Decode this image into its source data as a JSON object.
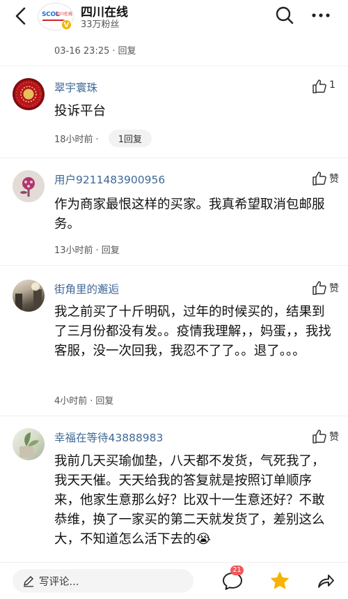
{
  "header": {
    "account_name": "四川在线",
    "fans": "33万粉丝",
    "logo_text": "SCOL",
    "logo_sub": "四川在线",
    "verified_mark": "V"
  },
  "top_comment": {
    "time": "03-16 23:25",
    "reply": "回复"
  },
  "comments": [
    {
      "user": "翠宇寰珠",
      "text": "投诉平台",
      "time": "18小时前",
      "reply": "1回复",
      "likes": "1"
    },
    {
      "user": "用户9211483900956",
      "text": "作为商家最恨这样的买家。我真希望取消包邮服务。",
      "time": "13小时前",
      "reply": "回复",
      "likes": "赞"
    },
    {
      "user": "街角里的邂逅",
      "text": "我之前买了十斤明矾，过年的时候买的，结果到了三月份都没有发。。疫情我理解，，妈蛋，，我找客服，没一次回我，我忍不了了。。退了。。。",
      "time": "4小时前",
      "reply": "回复",
      "likes": "赞"
    },
    {
      "user": "幸福在等待43888983",
      "text": "我前几天买瑜伽垫，八天都不发货，气死我了，我天天催。天天给我的答复就是按照订单顺序来，他家生意那么好？比双十一生意还好？不敢恭维，换了一家买的第二天就发货了，差别这么大，不知道怎么活下去的😭",
      "likes": "赞"
    }
  ],
  "bottom_bar": {
    "compose_placeholder": "写评论...",
    "comment_count": "21"
  },
  "colors": {
    "username_blue": "#3f6896",
    "badge_red": "#f0585a",
    "star_yellow": "#f5b400"
  }
}
